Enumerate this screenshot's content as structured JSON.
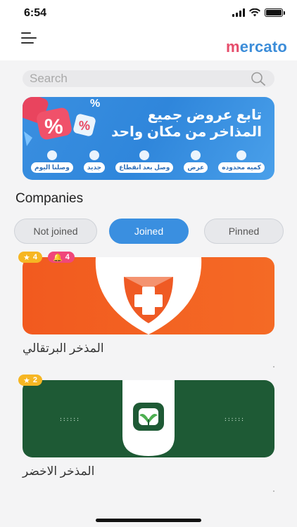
{
  "status_bar": {
    "time": "6:54"
  },
  "header": {
    "logo_m": "m",
    "logo_rest": "ercato"
  },
  "search": {
    "placeholder": "Search"
  },
  "banner": {
    "title": "تابع عروض جميع المذاخر من مكان واحد",
    "chips": [
      {
        "label": "كميه محدوده"
      },
      {
        "label": "عرض"
      },
      {
        "label": "وصل بعد انقطاع"
      },
      {
        "label": "جديد"
      },
      {
        "label": "وصلنا اليوم"
      }
    ]
  },
  "section": {
    "title": "Companies"
  },
  "tabs": [
    {
      "label": "Not joined",
      "active": false
    },
    {
      "label": "Joined",
      "active": true
    },
    {
      "label": "Pinned",
      "active": false
    }
  ],
  "companies": [
    {
      "name": "المذخر البرتقالي",
      "stars": "4",
      "notifications": "4",
      "brand_color": "#f05a22"
    },
    {
      "name": "المذخر الاخضر",
      "stars": "2",
      "notifications": "",
      "brand_color": "#1e5a35"
    }
  ],
  "colors": {
    "accent": "#3a8fe0",
    "star_badge": "#f6b623",
    "bell_badge": "#f0477a"
  }
}
